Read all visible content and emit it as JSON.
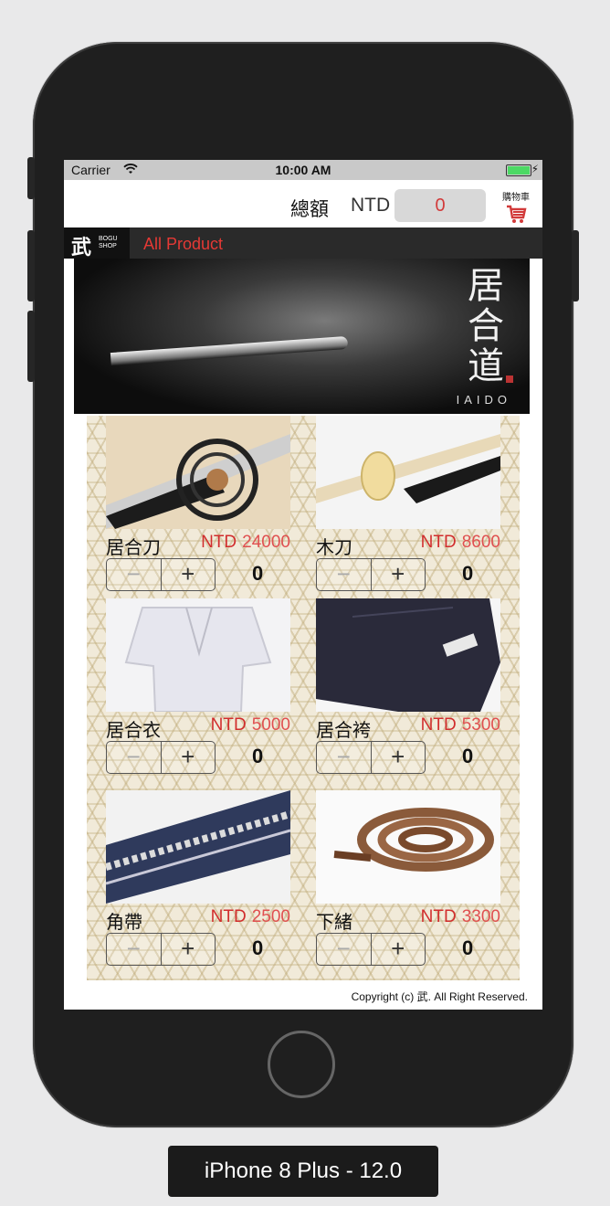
{
  "status": {
    "carrier": "Carrier",
    "time": "10:00 AM"
  },
  "header": {
    "total_label": "總額",
    "currency": "NTD",
    "total_value": "0",
    "cart_label": "購物車"
  },
  "nav": {
    "logo_kanji": "武",
    "logo_text_1": "BOGU",
    "logo_text_2": "SHOP",
    "all_product": "All Product"
  },
  "banner": {
    "vertical_text": "居合道",
    "latin_text": "IAIDO"
  },
  "products": [
    {
      "name": "居合刀",
      "currency": "NTD",
      "price": "24000",
      "qty": "0",
      "minus": "−",
      "plus": "+"
    },
    {
      "name": "木刀",
      "currency": "NTD",
      "price": "8600",
      "qty": "0",
      "minus": "−",
      "plus": "+"
    },
    {
      "name": "居合衣",
      "currency": "NTD",
      "price": "5000",
      "qty": "0",
      "minus": "−",
      "plus": "+"
    },
    {
      "name": "居合袴",
      "currency": "NTD",
      "price": "5300",
      "qty": "0",
      "minus": "−",
      "plus": "+"
    },
    {
      "name": "角帶",
      "currency": "NTD",
      "price": "2500",
      "qty": "0",
      "minus": "−",
      "plus": "+"
    },
    {
      "name": "下緒",
      "currency": "NTD",
      "price": "3300",
      "qty": "0",
      "minus": "−",
      "plus": "+"
    }
  ],
  "footer": {
    "copyright": "Copyright (c) 武. All Right Reserved."
  },
  "device": {
    "label": "iPhone 8 Plus - 12.0"
  },
  "colors": {
    "price": "#d12d2d",
    "nav_bg": "#2a2a2a",
    "accent": "#e53935"
  }
}
